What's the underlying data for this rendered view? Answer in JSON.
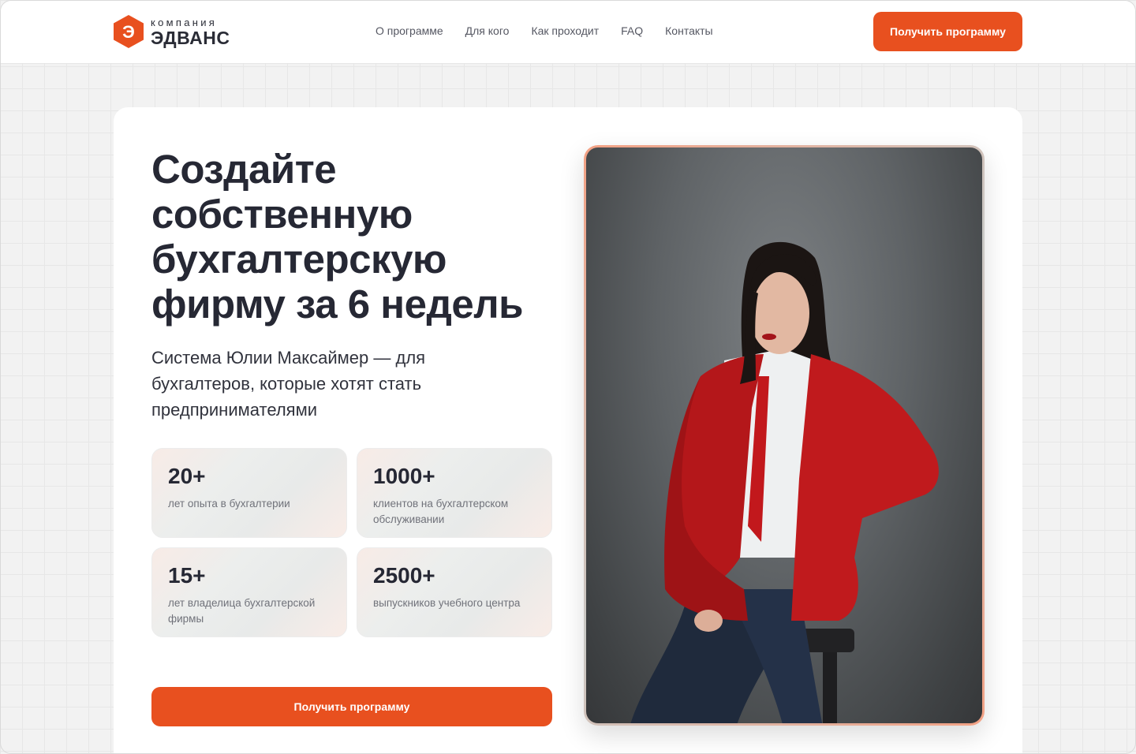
{
  "header": {
    "logo": {
      "small": "компания",
      "big": "ЭДВАНС",
      "mark": "Э"
    },
    "nav": [
      "О программе",
      "Для кого",
      "Как проходит",
      "FAQ",
      "Контакты"
    ],
    "cta_label": "Получить программу"
  },
  "hero": {
    "title": "Создайте собственную бухгалтерскую фирму за 6 недель",
    "subtitle": "Система Юлии Максаймер — для бухгалтеров, которые хотят стать предпринимателями",
    "stats": [
      {
        "value": "20+",
        "label": "лет опыта в бухгалтерии"
      },
      {
        "value": "1000+",
        "label": "клиентов на бухгалтерском обслуживании"
      },
      {
        "value": "15+",
        "label": "лет владелица бухгалтерской фирмы"
      },
      {
        "value": "2500+",
        "label": "выпускников учебного центра"
      }
    ],
    "cta_label": "Получить программу"
  },
  "colors": {
    "accent": "#e8501f",
    "text": "#262834"
  },
  "icons": {
    "logo": "logo-hexagon-icon"
  }
}
